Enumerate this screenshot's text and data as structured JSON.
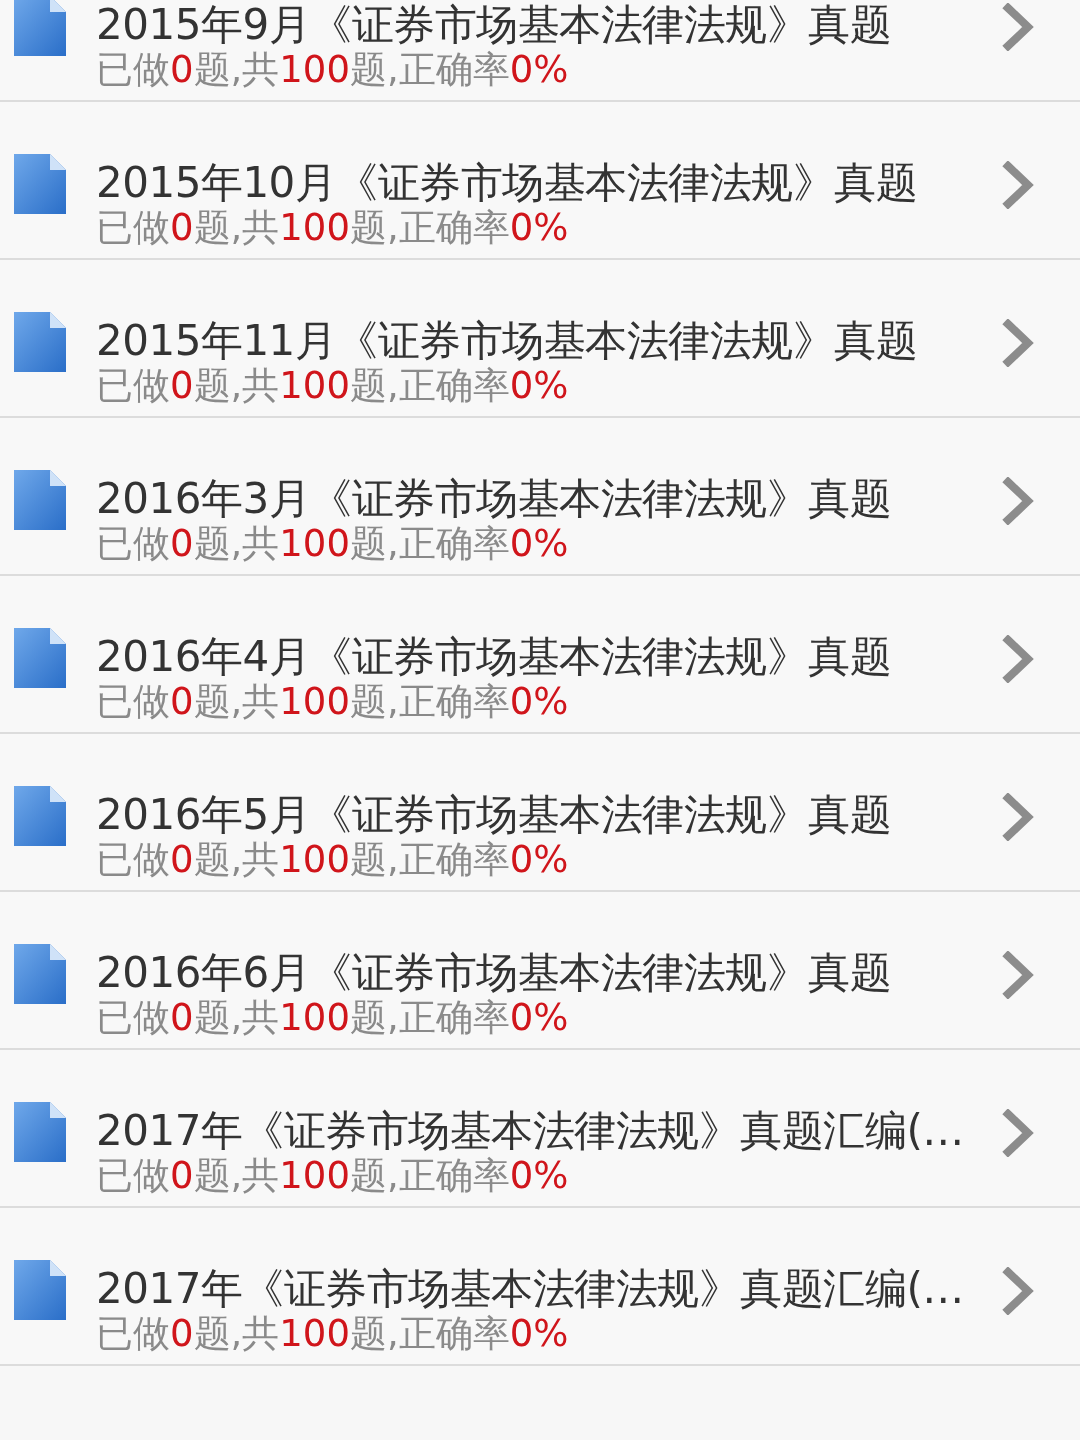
{
  "items": [
    {
      "title": "2015年9月《证券市场基本法律法规》真题",
      "progress": [
        {
          "text": "已做",
          "highlight": false
        },
        {
          "text": "0",
          "highlight": true
        },
        {
          "text": "题,共",
          "highlight": false
        },
        {
          "text": "100",
          "highlight": true
        },
        {
          "text": "题,正确率",
          "highlight": false
        },
        {
          "text": "0%",
          "highlight": true
        }
      ]
    },
    {
      "title": "2015年10月《证券市场基本法律法规》真题",
      "progress": [
        {
          "text": "已做",
          "highlight": false
        },
        {
          "text": "0",
          "highlight": true
        },
        {
          "text": "题,共",
          "highlight": false
        },
        {
          "text": "100",
          "highlight": true
        },
        {
          "text": "题,正确率",
          "highlight": false
        },
        {
          "text": "0%",
          "highlight": true
        }
      ]
    },
    {
      "title": "2015年11月《证券市场基本法律法规》真题",
      "progress": [
        {
          "text": "已做",
          "highlight": false
        },
        {
          "text": "0",
          "highlight": true
        },
        {
          "text": "题,共",
          "highlight": false
        },
        {
          "text": "100",
          "highlight": true
        },
        {
          "text": "题,正确率",
          "highlight": false
        },
        {
          "text": "0%",
          "highlight": true
        }
      ]
    },
    {
      "title": "2016年3月《证券市场基本法律法规》真题",
      "progress": [
        {
          "text": "已做",
          "highlight": false
        },
        {
          "text": "0",
          "highlight": true
        },
        {
          "text": "题,共",
          "highlight": false
        },
        {
          "text": "100",
          "highlight": true
        },
        {
          "text": "题,正确率",
          "highlight": false
        },
        {
          "text": "0%",
          "highlight": true
        }
      ]
    },
    {
      "title": "2016年4月《证券市场基本法律法规》真题",
      "progress": [
        {
          "text": "已做",
          "highlight": false
        },
        {
          "text": "0",
          "highlight": true
        },
        {
          "text": "题,共",
          "highlight": false
        },
        {
          "text": "100",
          "highlight": true
        },
        {
          "text": "题,正确率",
          "highlight": false
        },
        {
          "text": "0%",
          "highlight": true
        }
      ]
    },
    {
      "title": "2016年5月《证券市场基本法律法规》真题",
      "progress": [
        {
          "text": "已做",
          "highlight": false
        },
        {
          "text": "0",
          "highlight": true
        },
        {
          "text": "题,共",
          "highlight": false
        },
        {
          "text": "100",
          "highlight": true
        },
        {
          "text": "题,正确率",
          "highlight": false
        },
        {
          "text": "0%",
          "highlight": true
        }
      ]
    },
    {
      "title": "2016年6月《证券市场基本法律法规》真题",
      "progress": [
        {
          "text": "已做",
          "highlight": false
        },
        {
          "text": "0",
          "highlight": true
        },
        {
          "text": "题,共",
          "highlight": false
        },
        {
          "text": "100",
          "highlight": true
        },
        {
          "text": "题,正确率",
          "highlight": false
        },
        {
          "text": "0%",
          "highlight": true
        }
      ]
    },
    {
      "title": "2017年《证券市场基本法律法规》真题汇编(…",
      "progress": [
        {
          "text": "已做",
          "highlight": false
        },
        {
          "text": "0",
          "highlight": true
        },
        {
          "text": "题,共",
          "highlight": false
        },
        {
          "text": "100",
          "highlight": true
        },
        {
          "text": "题,正确率",
          "highlight": false
        },
        {
          "text": "0%",
          "highlight": true
        }
      ]
    },
    {
      "title": "2017年《证券市场基本法律法规》真题汇编(…",
      "progress": [
        {
          "text": "已做",
          "highlight": false
        },
        {
          "text": "0",
          "highlight": true
        },
        {
          "text": "题,共",
          "highlight": false
        },
        {
          "text": "100",
          "highlight": true
        },
        {
          "text": "题,正确率",
          "highlight": false
        },
        {
          "text": "0%",
          "highlight": true
        }
      ]
    }
  ]
}
